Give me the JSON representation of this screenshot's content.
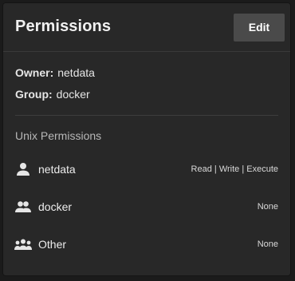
{
  "card": {
    "title": "Permissions",
    "edit_label": "Edit"
  },
  "owner": {
    "label": "Owner:",
    "value": "netdata"
  },
  "group": {
    "label": "Group:",
    "value": "docker"
  },
  "unix": {
    "section_title": "Unix Permissions",
    "rows": [
      {
        "icon": "person-icon",
        "name": "netdata",
        "value": "Read | Write | Execute"
      },
      {
        "icon": "people-icon",
        "name": "docker",
        "value": "None"
      },
      {
        "icon": "groups-icon",
        "name": "Other",
        "value": "None"
      }
    ]
  },
  "colors": {
    "page_background": "#1b1b1b",
    "card_background": "#282828",
    "button_background": "#4a4a4a",
    "divider": "#3d3d3d",
    "text_primary": "#e9e9e9",
    "text_muted": "#b8b8b8"
  }
}
